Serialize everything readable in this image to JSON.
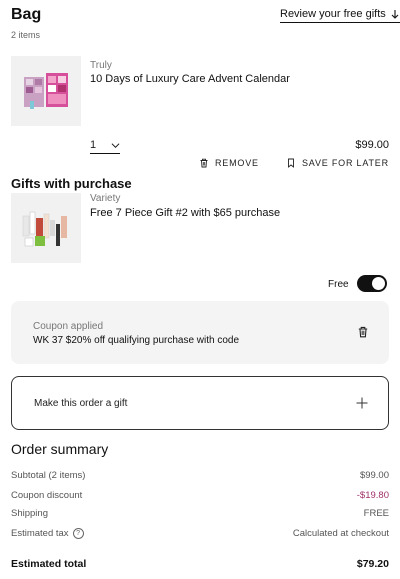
{
  "bag": {
    "title": "Bag",
    "count": "2 items",
    "review_link": "Review your free gifts"
  },
  "item": {
    "brand": "Truly",
    "name": "10 Days of Luxury Care Advent Calendar",
    "quantity": "1",
    "price": "$99.00",
    "remove_label": "REMOVE",
    "save_label": "SAVE FOR LATER"
  },
  "gifts": {
    "title": "Gifts with purchase",
    "brand": "Variety",
    "name": "Free 7 Piece Gift #2 with $65 purchase",
    "free_label": "Free"
  },
  "coupon": {
    "label": "Coupon applied",
    "code": "WK 37 $20% off qualifying purchase with code"
  },
  "gift_option": {
    "label": "Make this order a gift"
  },
  "summary": {
    "title": "Order summary",
    "rows": [
      {
        "label": "Subtotal (2 items)",
        "value": "$99.00"
      },
      {
        "label": "Coupon discount",
        "value": "-$19.80"
      },
      {
        "label": "Shipping",
        "value": "FREE"
      },
      {
        "label": "Estimated tax",
        "value": "Calculated at checkout"
      }
    ],
    "total_label": "Estimated total",
    "total_value": "$79.20"
  },
  "colors": {
    "discount": "#a0306a",
    "toggle_on": "#111111"
  }
}
